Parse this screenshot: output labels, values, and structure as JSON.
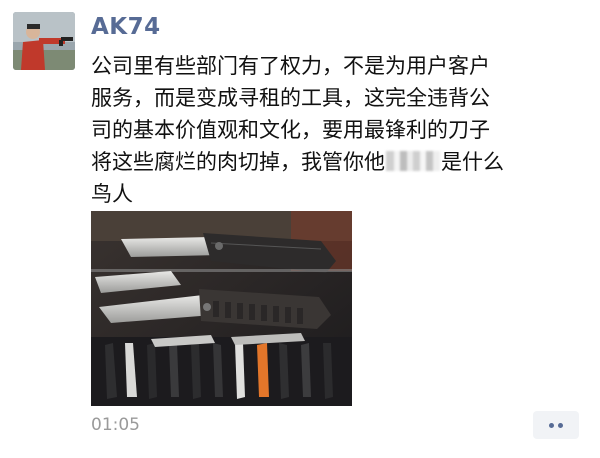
{
  "post": {
    "username": "AK74",
    "text_lines": [
      "公司里有些部门有了权力，不是为用户客户",
      "服务，而是变成寻租的工具，这完全违背公",
      "司的基本价值观和文化，要用最锋利的刀子",
      "将这些腐烂的肉切掉，我管你他",
      "是什么",
      "鸟人"
    ],
    "time": "01:05"
  },
  "icons": {
    "avatar": "shooter-avatar",
    "more": "more-dots-icon"
  },
  "colors": {
    "username": "#576b95",
    "text": "#111111",
    "time": "#9a9a9a"
  }
}
